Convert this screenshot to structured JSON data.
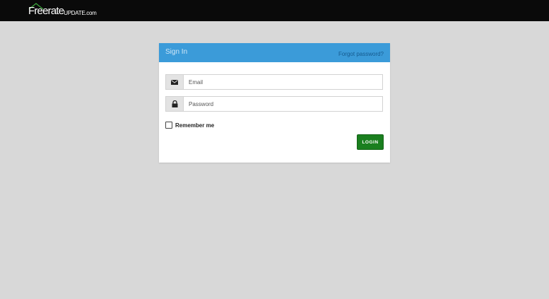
{
  "header": {
    "logo_main": "Freerate",
    "logo_sub": "UPDATE.com"
  },
  "signin": {
    "title": "Sign In",
    "forgot_label": "Forgot password?",
    "email_placeholder": "Email",
    "password_placeholder": "Password",
    "remember_label": "Remember me",
    "remember_checked": false,
    "login_label": "LOGIN"
  },
  "colors": {
    "header_bg": "#3b9bd9",
    "login_bg": "#1a7f1f",
    "topbar_bg": "#0a0a0a",
    "page_bg": "#d8d8d8"
  },
  "icons": {
    "email": "envelope-icon",
    "password": "lock-icon",
    "logo": "house-roof-icon"
  }
}
